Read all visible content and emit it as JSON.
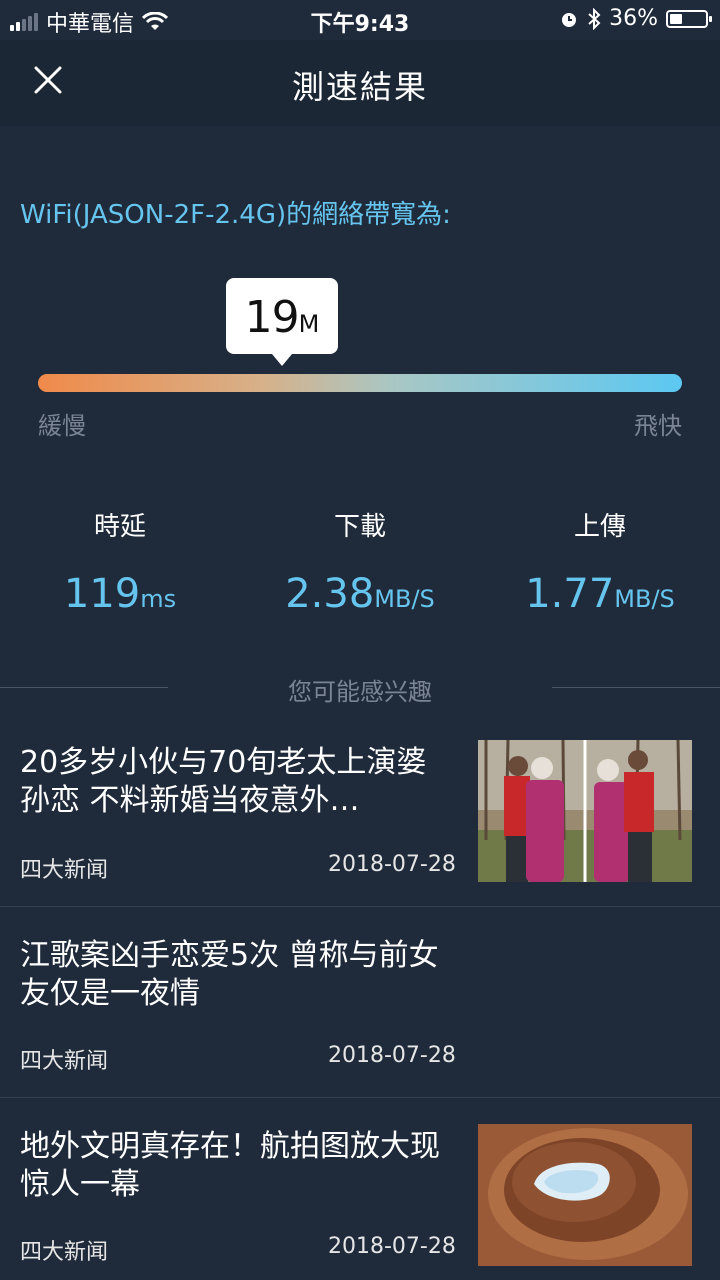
{
  "status_bar": {
    "carrier": "中華電信",
    "time": "下午9:43",
    "battery": "36%",
    "battery_level": 0.36,
    "icons": [
      "signal-icon",
      "wifi-icon",
      "alarm-icon",
      "bluetooth-icon",
      "battery-icon"
    ]
  },
  "header": {
    "title": "測速結果",
    "close_icon": "close-icon"
  },
  "speed": {
    "network_label": "WiFi(JASON-2F-2.4G)的網絡帶寬為:",
    "bandwidth_value": "19",
    "bandwidth_unit": "M",
    "slow_label": "緩慢",
    "fast_label": "飛快"
  },
  "metrics": [
    {
      "label": "時延",
      "value": "119",
      "unit": "ms"
    },
    {
      "label": "下載",
      "value": "2.38",
      "unit": "MB/S"
    },
    {
      "label": "上傳",
      "value": "1.77",
      "unit": "MB/S"
    }
  ],
  "recommend": {
    "heading": "您可能感兴趣"
  },
  "news": [
    {
      "title": "20多岁小伙与70旬老太上演婆孙恋 不料新婚当夜意外…",
      "source": "四大新闻",
      "date": "2018-07-28",
      "image": "couple-photo"
    },
    {
      "title": "江歌案凶手恋爱5次 曾称与前女友仅是一夜情",
      "source": "四大新闻",
      "date": "2018-07-28"
    },
    {
      "title": "地外文明真存在！航拍图放大现惊人一幕",
      "source": "四大新闻",
      "date": "2018-07-28",
      "image": "crater-photo"
    }
  ],
  "colors": {
    "background": "#1f2a3a",
    "accent": "#66c5ee",
    "bar_start": "#f08a4a",
    "bar_end": "#5cc8f2"
  }
}
